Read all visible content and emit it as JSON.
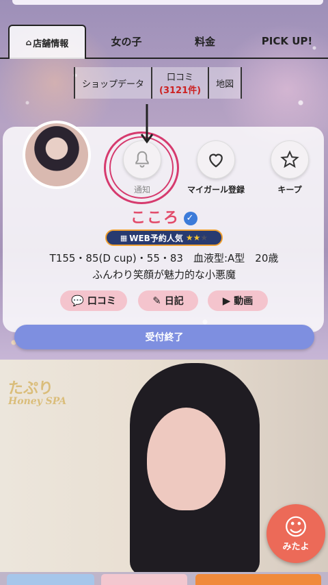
{
  "tabs": {
    "shop_info": "店舗情報",
    "girls": "女の子",
    "price": "料金",
    "pickup": "PICK UP!"
  },
  "subnav": {
    "shop_data": "ショップデータ",
    "reviews": "口コミ",
    "reviews_count": "(3121件)",
    "map": "地図"
  },
  "profile": {
    "actions": {
      "notify": "通知",
      "my_girl": "マイガール登録",
      "keep": "キープ"
    },
    "name": "こころ",
    "badge": {
      "label": "WEB予約人気",
      "rating": 2,
      "max": 3
    },
    "stats": "T155・85(D cup)・55・83　血液型:A型　20歳",
    "catchphrase": "ふんわり笑顔が魅力的な小悪魔",
    "buttons": {
      "reviews": "口コミ",
      "diary": "日記",
      "video": "動画"
    },
    "reception": "受付終了"
  },
  "photo": {
    "floating_button": "みたよ"
  },
  "colors": {
    "accent_pink": "#e24b6a",
    "highlight_ring": "#d63a6e",
    "reception_button": "#7e8fe0",
    "pill": "#f4c4cd",
    "mitayo": "#ec6a58"
  }
}
